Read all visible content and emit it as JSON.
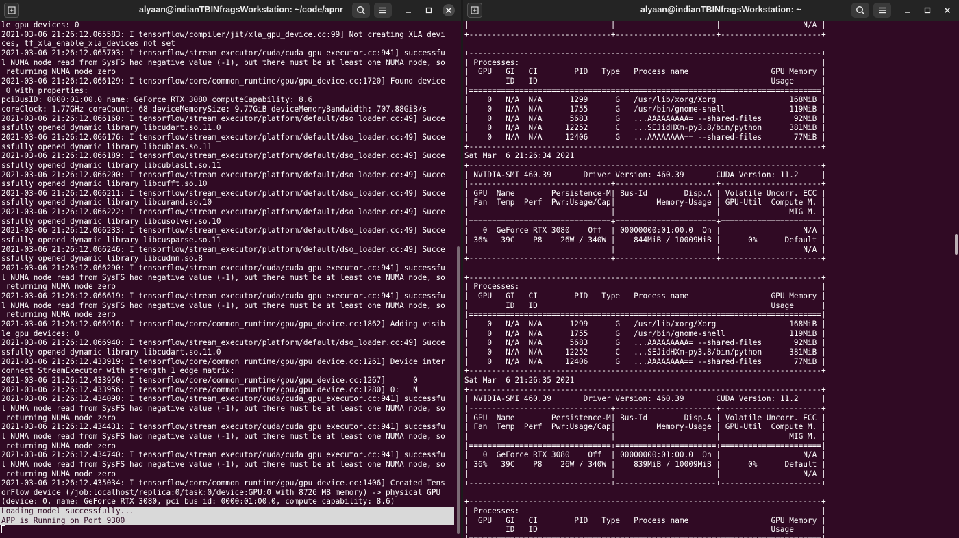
{
  "left_window": {
    "title": "alyaan@indianTBINfragsWorkstation: ~/code/apnr",
    "lines": [
      "le gpu devices: 0",
      "2021-03-06 21:26:12.065583: I tensorflow/compiler/jit/xla_gpu_device.cc:99] Not creating XLA devi",
      "ces, tf_xla_enable_xla_devices not set",
      "2021-03-06 21:26:12.065703: I tensorflow/stream_executor/cuda/cuda_gpu_executor.cc:941] successfu",
      "l NUMA node read from SysFS had negative value (-1), but there must be at least one NUMA node, so",
      " returning NUMA node zero",
      "2021-03-06 21:26:12.066129: I tensorflow/core/common_runtime/gpu/gpu_device.cc:1720] Found device",
      " 0 with properties:",
      "pciBusID: 0000:01:00.0 name: GeForce RTX 3080 computeCapability: 8.6",
      "coreClock: 1.77GHz coreCount: 68 deviceMemorySize: 9.77GiB deviceMemoryBandwidth: 707.88GiB/s",
      "2021-03-06 21:26:12.066160: I tensorflow/stream_executor/platform/default/dso_loader.cc:49] Succe",
      "ssfully opened dynamic library libcudart.so.11.0",
      "2021-03-06 21:26:12.066176: I tensorflow/stream_executor/platform/default/dso_loader.cc:49] Succe",
      "ssfully opened dynamic library libcublas.so.11",
      "2021-03-06 21:26:12.066189: I tensorflow/stream_executor/platform/default/dso_loader.cc:49] Succe",
      "ssfully opened dynamic library libcublasLt.so.11",
      "2021-03-06 21:26:12.066200: I tensorflow/stream_executor/platform/default/dso_loader.cc:49] Succe",
      "ssfully opened dynamic library libcufft.so.10",
      "2021-03-06 21:26:12.066211: I tensorflow/stream_executor/platform/default/dso_loader.cc:49] Succe",
      "ssfully opened dynamic library libcurand.so.10",
      "2021-03-06 21:26:12.066222: I tensorflow/stream_executor/platform/default/dso_loader.cc:49] Succe",
      "ssfully opened dynamic library libcusolver.so.10",
      "2021-03-06 21:26:12.066233: I tensorflow/stream_executor/platform/default/dso_loader.cc:49] Succe",
      "ssfully opened dynamic library libcusparse.so.11",
      "2021-03-06 21:26:12.066246: I tensorflow/stream_executor/platform/default/dso_loader.cc:49] Succe",
      "ssfully opened dynamic library libcudnn.so.8",
      "2021-03-06 21:26:12.066290: I tensorflow/stream_executor/cuda/cuda_gpu_executor.cc:941] successfu",
      "l NUMA node read from SysFS had negative value (-1), but there must be at least one NUMA node, so",
      " returning NUMA node zero",
      "2021-03-06 21:26:12.066619: I tensorflow/stream_executor/cuda/cuda_gpu_executor.cc:941] successfu",
      "l NUMA node read from SysFS had negative value (-1), but there must be at least one NUMA node, so",
      " returning NUMA node zero",
      "2021-03-06 21:26:12.066916: I tensorflow/core/common_runtime/gpu/gpu_device.cc:1862] Adding visib",
      "le gpu devices: 0",
      "2021-03-06 21:26:12.066940: I tensorflow/stream_executor/platform/default/dso_loader.cc:49] Succe",
      "ssfully opened dynamic library libcudart.so.11.0",
      "2021-03-06 21:26:12.433919: I tensorflow/core/common_runtime/gpu/gpu_device.cc:1261] Device inter",
      "connect StreamExecutor with strength 1 edge matrix:",
      "2021-03-06 21:26:12.433950: I tensorflow/core/common_runtime/gpu/gpu_device.cc:1267]      0",
      "2021-03-06 21:26:12.433956: I tensorflow/core/common_runtime/gpu/gpu_device.cc:1280] 0:   N",
      "2021-03-06 21:26:12.434090: I tensorflow/stream_executor/cuda/cuda_gpu_executor.cc:941] successfu",
      "l NUMA node read from SysFS had negative value (-1), but there must be at least one NUMA node, so",
      " returning NUMA node zero",
      "2021-03-06 21:26:12.434431: I tensorflow/stream_executor/cuda/cuda_gpu_executor.cc:941] successfu",
      "l NUMA node read from SysFS had negative value (-1), but there must be at least one NUMA node, so",
      " returning NUMA node zero",
      "2021-03-06 21:26:12.434740: I tensorflow/stream_executor/cuda/cuda_gpu_executor.cc:941] successfu",
      "l NUMA node read from SysFS had negative value (-1), but there must be at least one NUMA node, so",
      " returning NUMA node zero",
      "2021-03-06 21:26:12.435034: I tensorflow/core/common_runtime/gpu/gpu_device.cc:1406] Created Tens",
      "orFlow device (/job:localhost/replica:0/task:0/device:GPU:0 with 8726 MB memory) -> physical GPU",
      "(device: 0, name: GeForce RTX 3080, pci bus id: 0000:01:00.0, compute capability: 8.6)"
    ],
    "highlighted_lines": [
      "Loading model successfully...",
      "APP is Running on Port 9300"
    ]
  },
  "right_window": {
    "title": "alyaan@indianTBINfragsWorkstation: ~",
    "lines": [
      "|                               |                      |                  N/A |",
      "+-------------------------------+----------------------+----------------------+",
      "",
      "+-----------------------------------------------------------------------------+",
      "| Processes:                                                                  |",
      "|  GPU   GI   CI        PID   Type   Process name                  GPU Memory |",
      "|        ID   ID                                                   Usage      |",
      "|=============================================================================|",
      "|    0   N/A  N/A      1299      G   /usr/lib/xorg/Xorg                168MiB |",
      "|    0   N/A  N/A      1755      G   /usr/bin/gnome-shell              119MiB |",
      "|    0   N/A  N/A      5683      G   ...AAAAAAAAA= --shared-files       92MiB |",
      "|    0   N/A  N/A     12252      C   ...SEJidHXm-py3.8/bin/python      381MiB |",
      "|    0   N/A  N/A     12406      G   ...AAAAAAAA== --shared-files       77MiB |",
      "+-----------------------------------------------------------------------------+",
      "Sat Mar  6 21:26:34 2021",
      "+-----------------------------------------------------------------------------+",
      "| NVIDIA-SMI 460.39       Driver Version: 460.39       CUDA Version: 11.2     |",
      "|-------------------------------+----------------------+----------------------+",
      "| GPU  Name        Persistence-M| Bus-Id        Disp.A | Volatile Uncorr. ECC |",
      "| Fan  Temp  Perf  Pwr:Usage/Cap|         Memory-Usage | GPU-Util  Compute M. |",
      "|                               |                      |               MIG M. |",
      "|===============================+======================+======================|",
      "|   0  GeForce RTX 3080    Off  | 00000000:01:00.0  On |                  N/A |",
      "| 36%   39C    P8    26W / 340W |    844MiB / 10009MiB |      0%      Default |",
      "|                               |                      |                  N/A |",
      "+-------------------------------+----------------------+----------------------+",
      "",
      "+-----------------------------------------------------------------------------+",
      "| Processes:                                                                  |",
      "|  GPU   GI   CI        PID   Type   Process name                  GPU Memory |",
      "|        ID   ID                                                   Usage      |",
      "|=============================================================================|",
      "|    0   N/A  N/A      1299      G   /usr/lib/xorg/Xorg                168MiB |",
      "|    0   N/A  N/A      1755      G   /usr/bin/gnome-shell              119MiB |",
      "|    0   N/A  N/A      5683      G   ...AAAAAAAAA= --shared-files       92MiB |",
      "|    0   N/A  N/A     12252      C   ...SEJidHXm-py3.8/bin/python      381MiB |",
      "|    0   N/A  N/A     12406      G   ...AAAAAAAA== --shared-files       77MiB |",
      "+-----------------------------------------------------------------------------+",
      "Sat Mar  6 21:26:35 2021",
      "+-----------------------------------------------------------------------------+",
      "| NVIDIA-SMI 460.39       Driver Version: 460.39       CUDA Version: 11.2     |",
      "|-------------------------------+----------------------+----------------------+",
      "| GPU  Name        Persistence-M| Bus-Id        Disp.A | Volatile Uncorr. ECC |",
      "| Fan  Temp  Perf  Pwr:Usage/Cap|         Memory-Usage | GPU-Util  Compute M. |",
      "|                               |                      |               MIG M. |",
      "|===============================+======================+======================|",
      "|   0  GeForce RTX 3080    Off  | 00000000:01:00.0  On |                  N/A |",
      "| 36%   39C    P8    26W / 340W |    839MiB / 10009MiB |      0%      Default |",
      "|                               |                      |                  N/A |",
      "+-------------------------------+----------------------+----------------------+",
      "",
      "+-----------------------------------------------------------------------------+",
      "| Processes:                                                                  |",
      "|  GPU   GI   CI        PID   Type   Process name                  GPU Memory |",
      "|        ID   ID                                                   Usage      |",
      "|=============================================================================|"
    ]
  },
  "icons": {
    "new_tab": "new-tab-icon",
    "search": "search-icon",
    "menu": "hamburger-menu-icon",
    "minimize": "minimize-icon",
    "maximize": "maximize-icon",
    "close": "close-icon"
  },
  "colors": {
    "terminal_bg": "#300a24",
    "titlebar_bg": "#242424",
    "text": "#ffffff",
    "selection_bg": "#d9d9d9"
  }
}
